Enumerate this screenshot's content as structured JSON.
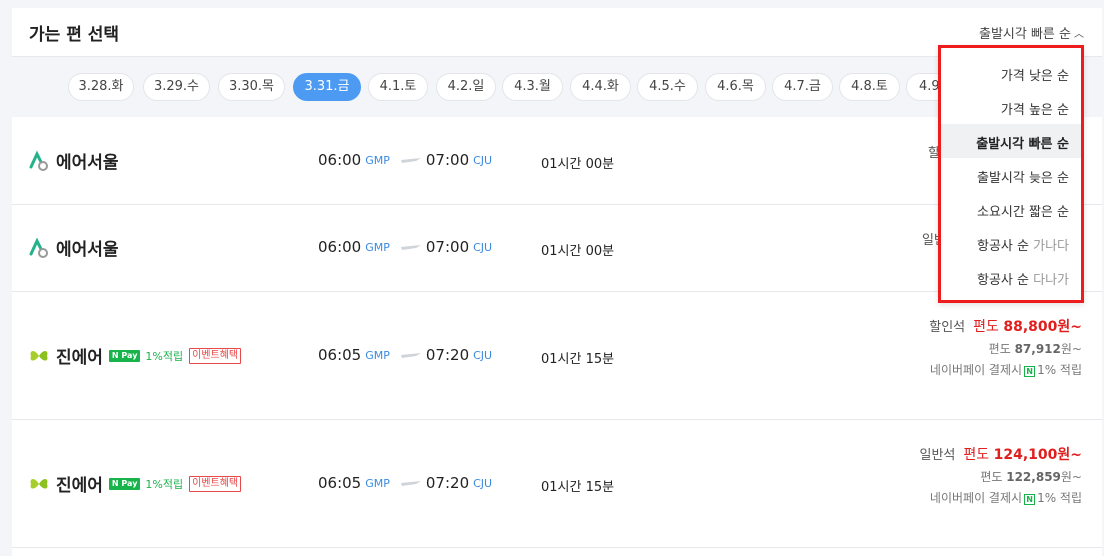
{
  "header": {
    "title": "가는 편 선택",
    "sort_label": "출발시각 빠른 순",
    "sort_chevron": "^"
  },
  "dates": [
    {
      "label": "3.28.화",
      "active": false
    },
    {
      "label": "3.29.수",
      "active": false
    },
    {
      "label": "3.30.목",
      "active": false
    },
    {
      "label": "3.31.금",
      "active": true
    },
    {
      "label": "4.1.토",
      "active": false
    },
    {
      "label": "4.2.일",
      "active": false
    },
    {
      "label": "4.3.월",
      "active": false
    },
    {
      "label": "4.4.화",
      "active": false
    },
    {
      "label": "4.5.수",
      "active": false
    },
    {
      "label": "4.6.목",
      "active": false
    },
    {
      "label": "4.7.금",
      "active": false
    },
    {
      "label": "4.8.토",
      "active": false
    },
    {
      "label": "4.9",
      "active": false
    }
  ],
  "flights": [
    {
      "airline": "에어서울",
      "dep_time": "06:00",
      "dep_code": "GMP",
      "arr_time": "07:00",
      "arr_code": "CJU",
      "duration": "01시간 00분",
      "fare_partial": "할"
    },
    {
      "airline": "에어서울",
      "dep_time": "06:00",
      "dep_code": "GMP",
      "arr_time": "07:00",
      "arr_code": "CJU",
      "duration": "01시간 00분",
      "fare_partial": "일반"
    },
    {
      "airline": "진에어",
      "pay_badge": "N Pay",
      "reward": "1%적립",
      "event": "이벤트혜택",
      "dep_time": "06:05",
      "dep_code": "GMP",
      "arr_time": "07:20",
      "arr_code": "CJU",
      "duration": "01시간 15분",
      "seat_class": "할인석",
      "price_prefix": "편도",
      "price": "88,800원~",
      "sub_prefix": "편도",
      "sub_price": "87,912",
      "sub_suffix": "원~",
      "naverpay_note": "네이버페이 결제시",
      "naverpay_reward": "1% 적립"
    },
    {
      "airline": "진에어",
      "pay_badge": "N Pay",
      "reward": "1%적립",
      "event": "이벤트혜택",
      "dep_time": "06:05",
      "dep_code": "GMP",
      "arr_time": "07:20",
      "arr_code": "CJU",
      "duration": "01시간 15분",
      "seat_class": "일반석",
      "price_prefix": "편도",
      "price": "124,100원~",
      "sub_prefix": "편도",
      "sub_price": "122,859",
      "sub_suffix": "원~",
      "naverpay_note": "네이버페이 결제시",
      "naverpay_reward": "1% 적립"
    }
  ],
  "sort_menu": {
    "options": [
      {
        "label": "가격 낮은 순",
        "sub": ""
      },
      {
        "label": "가격 높은 순",
        "sub": ""
      },
      {
        "label": "출발시각 빠른 순",
        "sub": ""
      },
      {
        "label": "출발시각 늦은 순",
        "sub": ""
      },
      {
        "label": "소요시간 짧은 순",
        "sub": ""
      },
      {
        "label": "항공사 순",
        "sub": "가나다"
      },
      {
        "label": "항공사 순",
        "sub": "다나가"
      }
    ],
    "selected_index": 2
  },
  "colors": {
    "accent": "#4d9af3",
    "price_red": "#e01e1e",
    "npay_green": "#19b34b",
    "highlight_border": "#ee1c1c"
  },
  "icons": {
    "airseoul_logo": "airseoul-logo",
    "jinair_logo": "jinair-butterfly-logo",
    "plane": "plane-icon"
  }
}
